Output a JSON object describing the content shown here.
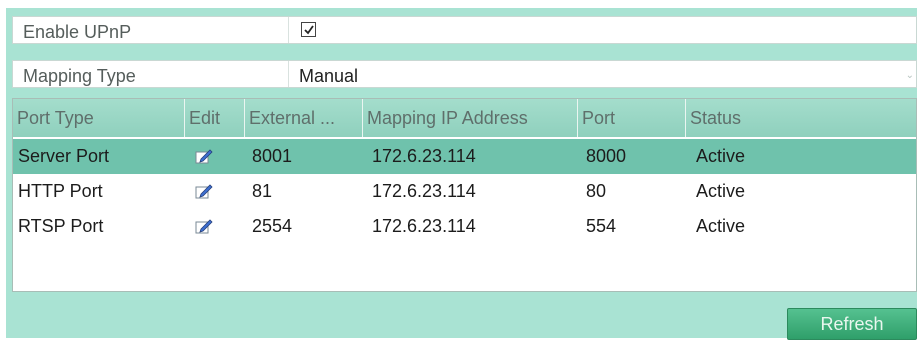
{
  "upnp": {
    "label": "Enable UPnP",
    "checked": true,
    "check_icon": "checkmark-icon"
  },
  "mapping_type": {
    "label": "Mapping Type",
    "value": "Manual",
    "arrow_icon": "chevron-down-icon"
  },
  "table": {
    "columns": [
      "Port Type",
      "Edit",
      "External ...",
      "Mapping IP Address",
      "Port",
      "Status"
    ],
    "edit_icon": "pencil-edit-icon",
    "rows": [
      {
        "port_type": "Server Port",
        "external": "8001",
        "ip": "172.6.23.114",
        "port": "8000",
        "status": "Active",
        "selected": true
      },
      {
        "port_type": "HTTP Port",
        "external": "81",
        "ip": "172.6.23.114",
        "port": "80",
        "status": "Active",
        "selected": false
      },
      {
        "port_type": "RTSP Port",
        "external": "2554",
        "ip": "172.6.23.114",
        "port": "554",
        "status": "Active",
        "selected": false
      }
    ]
  },
  "buttons": {
    "refresh": "Refresh"
  },
  "colors": {
    "panel_bg": "#a9e3d3",
    "header_bg": "#8fd0bd",
    "selected_row": "#6fc2ac",
    "button": "#3aa874"
  }
}
